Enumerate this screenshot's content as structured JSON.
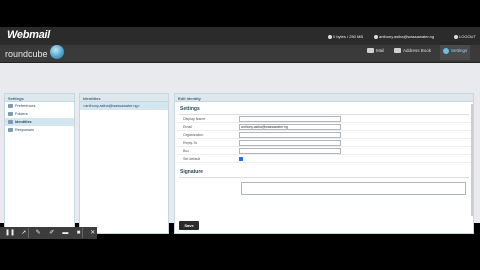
{
  "header": {
    "brand": "Webmail",
    "quota": "0 bytes / 250 MB",
    "user": "anthony.asiba@wassawater.ng",
    "logout": "LOGOUT"
  },
  "appbar": {
    "logo": "roundcube",
    "nav": [
      {
        "label": "Mail",
        "icon": "mail-icon"
      },
      {
        "label": "Address Book",
        "icon": "address-book-icon"
      },
      {
        "label": "Settings",
        "icon": "gear-icon"
      }
    ]
  },
  "settings": {
    "title": "Settings",
    "items": [
      {
        "label": "Preferences",
        "icon": "preferences-icon"
      },
      {
        "label": "Folders",
        "icon": "folder-icon"
      },
      {
        "label": "Identities",
        "icon": "identities-icon"
      },
      {
        "label": "Responses",
        "icon": "responses-icon"
      }
    ]
  },
  "identities": {
    "title": "Identities",
    "items": [
      "<anthony.asiba@wassawater.ng>"
    ]
  },
  "edit": {
    "title": "Edit Identity",
    "section_settings": "Settings",
    "fields": [
      {
        "label": "Display Name",
        "value": ""
      },
      {
        "label": "Email",
        "value": "anthony.asiba@wassawater.ng"
      },
      {
        "label": "Organization",
        "value": ""
      },
      {
        "label": "Reply-To",
        "value": ""
      },
      {
        "label": "Bcc",
        "value": ""
      }
    ],
    "default_label": "Set default",
    "section_signature": "Signature",
    "save_label": "Save"
  },
  "colors": {
    "accent": "#3d6883",
    "selected": "#d4e6f0",
    "topbar": "#2b2b2b"
  }
}
